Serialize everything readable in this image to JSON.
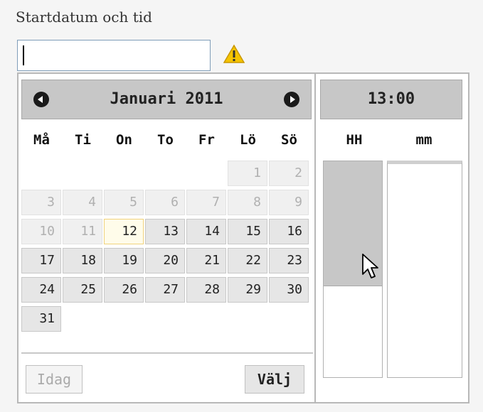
{
  "field": {
    "label": "Startdatum och tid",
    "value": "",
    "warning_icon": "warning-icon"
  },
  "calendar": {
    "month_title": "Januari 2011",
    "prev_icon": "prev-month-icon",
    "next_icon": "next-month-icon",
    "weekdays": [
      "Må",
      "Ti",
      "On",
      "To",
      "Fr",
      "Lö",
      "Sö"
    ],
    "days": [
      {
        "label": "",
        "state": "blank"
      },
      {
        "label": "",
        "state": "blank"
      },
      {
        "label": "",
        "state": "blank"
      },
      {
        "label": "",
        "state": "blank"
      },
      {
        "label": "",
        "state": "blank"
      },
      {
        "label": "1",
        "state": "disabled"
      },
      {
        "label": "2",
        "state": "disabled"
      },
      {
        "label": "3",
        "state": "disabled"
      },
      {
        "label": "4",
        "state": "disabled"
      },
      {
        "label": "5",
        "state": "disabled"
      },
      {
        "label": "6",
        "state": "disabled"
      },
      {
        "label": "7",
        "state": "disabled"
      },
      {
        "label": "8",
        "state": "disabled"
      },
      {
        "label": "9",
        "state": "disabled"
      },
      {
        "label": "10",
        "state": "disabled"
      },
      {
        "label": "11",
        "state": "disabled"
      },
      {
        "label": "12",
        "state": "today"
      },
      {
        "label": "13",
        "state": "active"
      },
      {
        "label": "14",
        "state": "active"
      },
      {
        "label": "15",
        "state": "active"
      },
      {
        "label": "16",
        "state": "active"
      },
      {
        "label": "17",
        "state": "active"
      },
      {
        "label": "18",
        "state": "active"
      },
      {
        "label": "19",
        "state": "active"
      },
      {
        "label": "20",
        "state": "active"
      },
      {
        "label": "21",
        "state": "active"
      },
      {
        "label": "22",
        "state": "active"
      },
      {
        "label": "23",
        "state": "active"
      },
      {
        "label": "24",
        "state": "active"
      },
      {
        "label": "25",
        "state": "active"
      },
      {
        "label": "26",
        "state": "active"
      },
      {
        "label": "27",
        "state": "active"
      },
      {
        "label": "28",
        "state": "active"
      },
      {
        "label": "29",
        "state": "active"
      },
      {
        "label": "30",
        "state": "active"
      },
      {
        "label": "31",
        "state": "active"
      }
    ],
    "today_button": "Idag",
    "select_button": "Välj"
  },
  "time": {
    "display": "13:00",
    "hour_label": "HH",
    "minute_label": "mm",
    "hour_fill_fraction": 0.58
  },
  "colors": {
    "header_bg": "#c7c7c7",
    "today_bg": "#fffcea",
    "warning": "#f5c400"
  }
}
